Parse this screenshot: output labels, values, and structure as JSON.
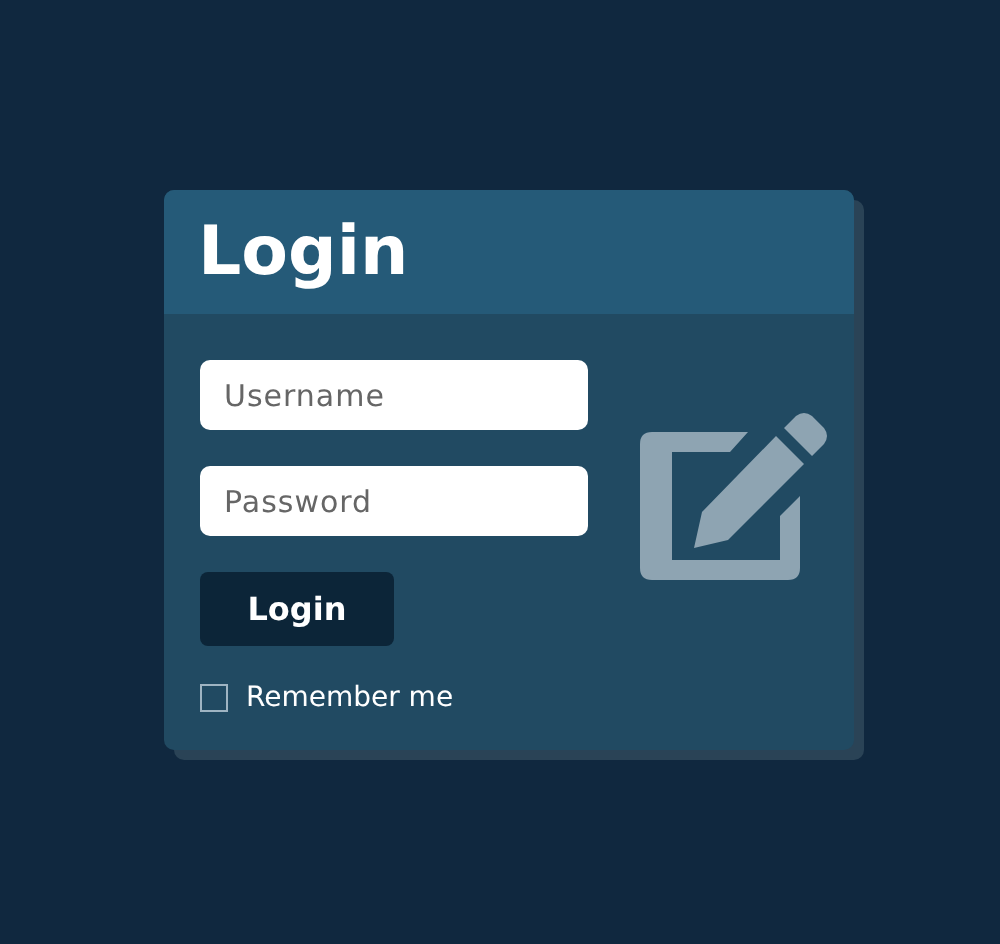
{
  "card": {
    "title": "Login"
  },
  "fields": [
    {
      "placeholder": "Username"
    },
    {
      "placeholder": "Password"
    }
  ],
  "submit": {
    "label": "Login"
  },
  "remember": {
    "label": "Remember me",
    "checked": false
  }
}
